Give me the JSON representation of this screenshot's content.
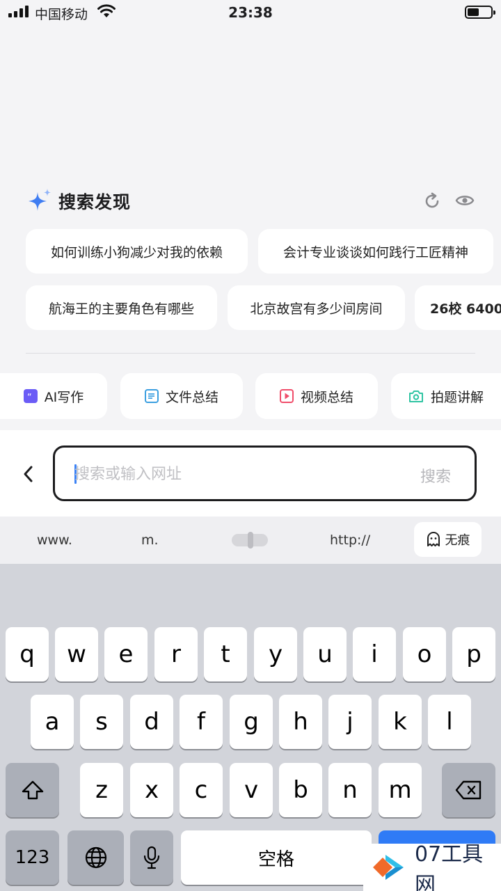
{
  "status_bar": {
    "carrier": "中国移动",
    "time": "23:38"
  },
  "discovery": {
    "title": "搜索发现",
    "row1": [
      "如何训练小狗减少对我的依赖",
      "会计专业谈谈如何践行工匠精神"
    ],
    "row2": [
      "航海王的主要角色有哪些",
      "北京故宫有多少间房间",
      "26校 6400"
    ]
  },
  "tools": [
    "AI写作",
    "文件总结",
    "视频总结",
    "拍题讲解"
  ],
  "search": {
    "placeholder": "搜索或输入网址",
    "button": "搜索"
  },
  "quick_inputs": {
    "www": "www.",
    "m": "m.",
    "http": "http://",
    "incognito": "无痕"
  },
  "keyboard": {
    "row1": [
      "q",
      "w",
      "e",
      "r",
      "t",
      "y",
      "u",
      "i",
      "o",
      "p"
    ],
    "row2": [
      "a",
      "s",
      "d",
      "f",
      "g",
      "h",
      "j",
      "k",
      "l"
    ],
    "row3": [
      "z",
      "x",
      "c",
      "v",
      "b",
      "n",
      "m"
    ],
    "numbers": "123",
    "space": "空格"
  },
  "watermark": "07工具网",
  "colors": {
    "accent": "#2f7bf6",
    "write_icon": "#6b5cf6",
    "file_icon": "#3b9fe0",
    "video_icon": "#f04d6a",
    "photo_icon": "#2fc4a2"
  }
}
